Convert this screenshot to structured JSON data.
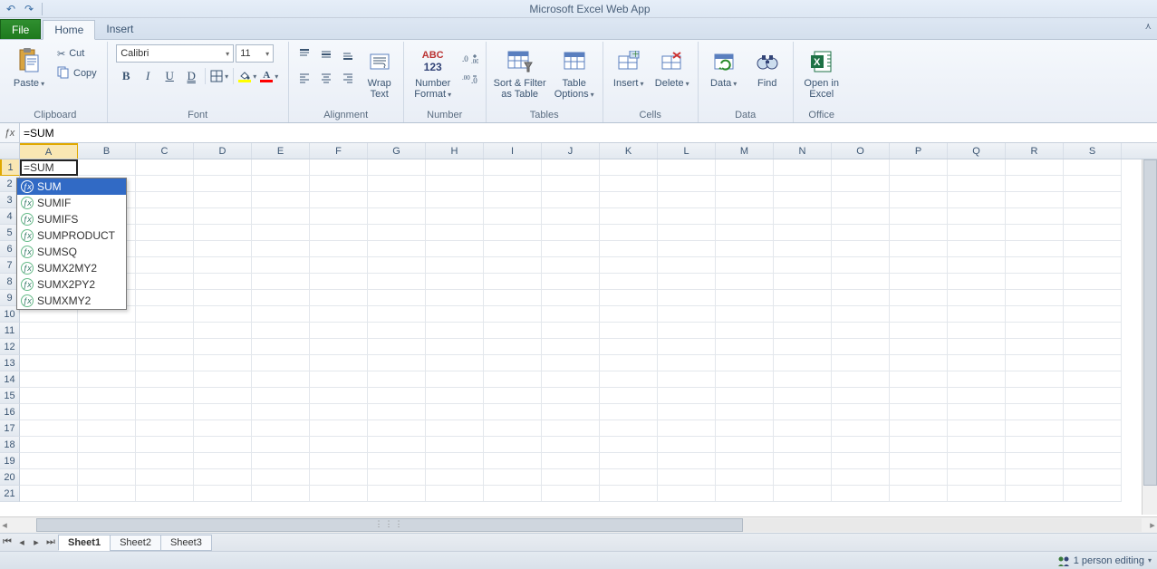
{
  "app_title": "Microsoft Excel Web App",
  "tabs": {
    "file": "File",
    "home": "Home",
    "insert": "Insert"
  },
  "clipboard": {
    "paste": "Paste",
    "cut": "Cut",
    "copy": "Copy",
    "label": "Clipboard"
  },
  "font": {
    "name": "Calibri",
    "size": "11",
    "label": "Font",
    "bold": "B",
    "italic": "I",
    "underline": "U",
    "dblunder": "D"
  },
  "alignment": {
    "wrap": "Wrap\nText",
    "label": "Alignment"
  },
  "number": {
    "abc123_top": "ABC",
    "abc123_bot": "123",
    "format": "Number\nFormat",
    "label": "Number"
  },
  "tables": {
    "sort": "Sort & Filter\nas Table",
    "options": "Table\nOptions",
    "label": "Tables"
  },
  "cells": {
    "insert": "Insert",
    "delete": "Delete",
    "label": "Cells"
  },
  "data": {
    "data": "Data",
    "find": "Find",
    "label": "Data"
  },
  "office": {
    "open": "Open in\nExcel",
    "label": "Office"
  },
  "formula_bar": {
    "value": "=SUM"
  },
  "cell_a1": "=SUM",
  "columns": [
    "A",
    "B",
    "C",
    "D",
    "E",
    "F",
    "G",
    "H",
    "I",
    "J",
    "K",
    "L",
    "M",
    "N",
    "O",
    "P",
    "Q",
    "R",
    "S"
  ],
  "rows": [
    "1",
    "2",
    "3",
    "4",
    "5",
    "6",
    "7",
    "8",
    "9",
    "10",
    "11",
    "12",
    "13",
    "14",
    "15",
    "16",
    "17",
    "18",
    "19",
    "20",
    "21"
  ],
  "autocomplete": [
    "SUM",
    "SUMIF",
    "SUMIFS",
    "SUMPRODUCT",
    "SUMSQ",
    "SUMX2MY2",
    "SUMX2PY2",
    "SUMXMY2"
  ],
  "sheets": [
    "Sheet1",
    "Sheet2",
    "Sheet3"
  ],
  "status": {
    "editing": "1 person editing"
  }
}
